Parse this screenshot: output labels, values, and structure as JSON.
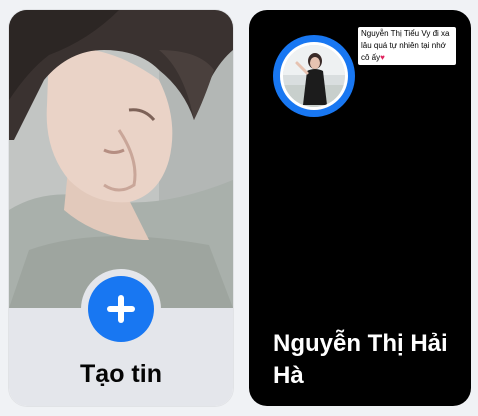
{
  "create_story": {
    "label": "Tạo tin",
    "plus_icon": "plus-icon"
  },
  "friend_story": {
    "author_name": "Nguyễn Thị Hải Hà",
    "caption_text": "Nguyễn Thị Tiểu Vy đi xa lâu quá tự nhiên tại nhớ cô ấy",
    "caption_emoji": "♥",
    "avatar_ring_color": "#1877f2"
  },
  "colors": {
    "accent": "#1877f2",
    "create_footer": "#e4e6eb",
    "story_background": "#000000"
  }
}
